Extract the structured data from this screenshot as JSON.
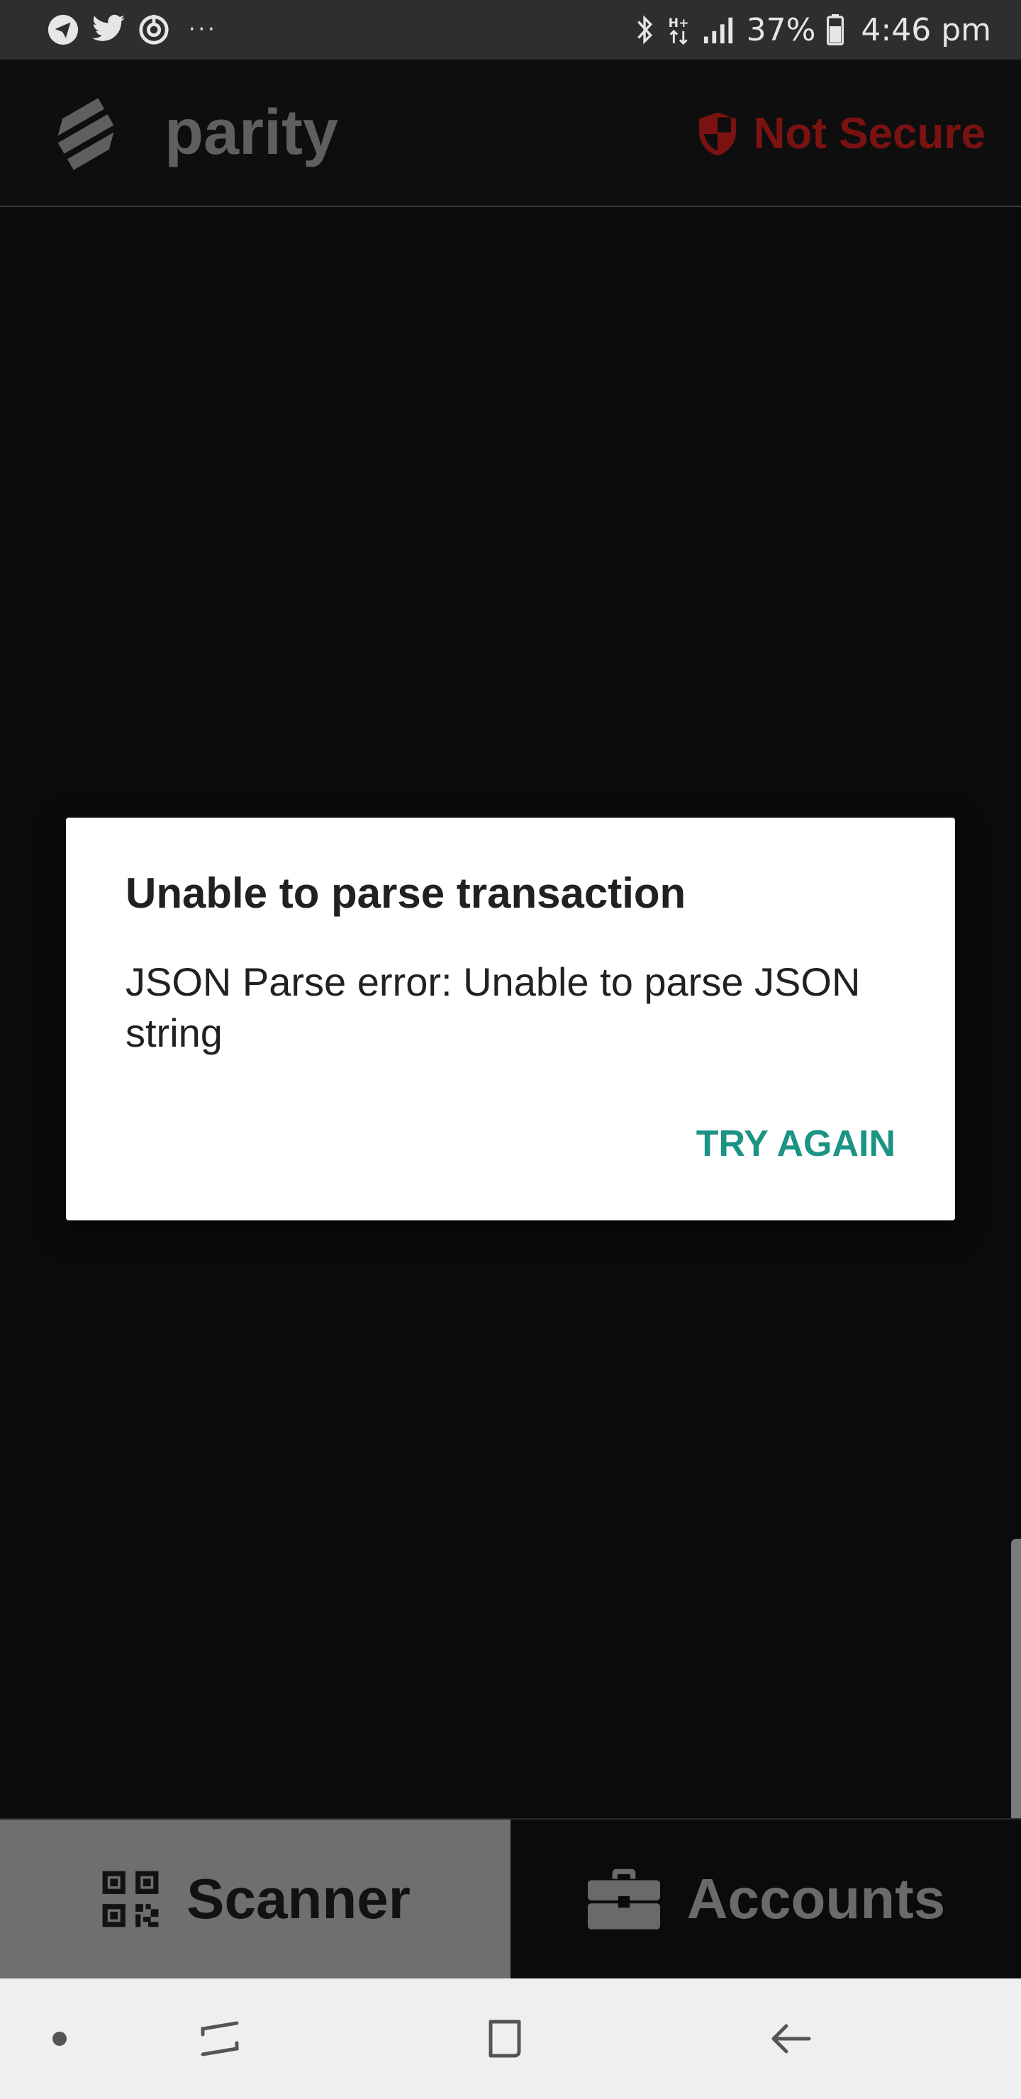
{
  "status_bar": {
    "battery_percent": "37%",
    "time": "4:46 pm",
    "overflow": "···",
    "icons": [
      "telegram-icon",
      "twitter-icon",
      "sync-icon",
      "bluetooth-icon",
      "data-hplus-icon",
      "signal-icon",
      "battery-icon"
    ]
  },
  "header": {
    "brand": "parity",
    "security_label": "Not Secure",
    "security_color": "#7b1212"
  },
  "dialog": {
    "title": "Unable to parse transaction",
    "message": "JSON Parse error: Unable to parse JSON string",
    "button": "TRY AGAIN",
    "accent_color": "#1c9484"
  },
  "tabs": [
    {
      "label": "Scanner",
      "icon": "qr-code-icon",
      "active": true
    },
    {
      "label": "Accounts",
      "icon": "briefcase-icon",
      "active": false
    }
  ],
  "nav_bar": {
    "buttons": [
      "dot-icon",
      "recent-apps-icon",
      "home-icon",
      "back-icon"
    ]
  }
}
